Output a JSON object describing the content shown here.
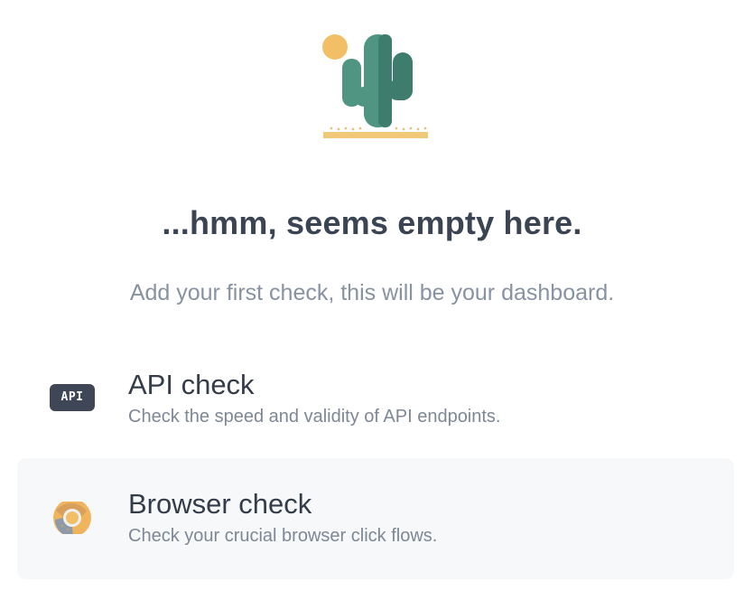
{
  "empty_state": {
    "illustration": "cactus-illustration",
    "title": "...hmm, seems empty here.",
    "subtitle": "Add your first check, this will be your dashboard."
  },
  "options": [
    {
      "icon": "api-icon",
      "badge": "API",
      "title": "API check",
      "description": "Check the speed and validity of API endpoints."
    },
    {
      "icon": "browser-icon",
      "title": "Browser check",
      "description": "Check your crucial browser click flows."
    }
  ],
  "colors": {
    "cactus_dark": "#3e7c6e",
    "cactus_light": "#4f9582",
    "sun": "#f2bf66",
    "sand": "#f0c878",
    "title_text": "#3b4453",
    "muted_text": "#8792a2",
    "api_badge_bg": "#3f4756",
    "selected_option_bg": "#f6f8fa"
  }
}
